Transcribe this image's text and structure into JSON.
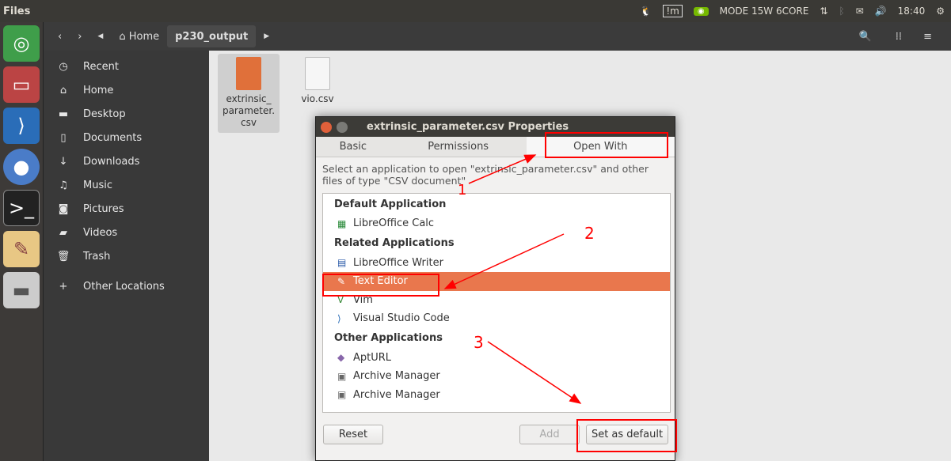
{
  "topbar": {
    "title": "Files",
    "mode": "MODE 15W 6CORE",
    "time": "18:40"
  },
  "launcher": [
    "ubuntu-icon",
    "files-icon",
    "vscode-icon",
    "chromium-icon",
    "terminal-icon",
    "text-editor-icon",
    "drive-icon"
  ],
  "headerbar": {
    "crumbs": [
      "Home",
      "p230_output"
    ]
  },
  "sidebar": {
    "items": [
      {
        "label": "Recent",
        "icon": "clock-icon"
      },
      {
        "label": "Home",
        "icon": "home-icon"
      },
      {
        "label": "Desktop",
        "icon": "folder-icon"
      },
      {
        "label": "Documents",
        "icon": "document-icon"
      },
      {
        "label": "Downloads",
        "icon": "download-icon"
      },
      {
        "label": "Music",
        "icon": "music-icon"
      },
      {
        "label": "Pictures",
        "icon": "camera-icon"
      },
      {
        "label": "Videos",
        "icon": "video-icon"
      },
      {
        "label": "Trash",
        "icon": "trash-icon"
      },
      {
        "label": "Other Locations",
        "icon": "plus-icon"
      }
    ]
  },
  "files": [
    {
      "name": "extrinsic_\nparameter.\ncsv",
      "color": "#e0703a"
    },
    {
      "name": "vio.csv",
      "color": "#f4f4f4"
    }
  ],
  "dialog": {
    "title": "extrinsic_parameter.csv Properties",
    "tabs": [
      "Basic",
      "Permissions",
      "Open With"
    ],
    "description": "Select an application to open \"extrinsic_parameter.csv\" and other files of type \"CSV document\"",
    "sections": {
      "default": "Default Application",
      "related": "Related Applications",
      "other": "Other Applications"
    },
    "default_apps": [
      "LibreOffice Calc"
    ],
    "related_apps": [
      "LibreOffice Writer",
      "Text Editor",
      "Vim",
      "Visual Studio Code"
    ],
    "other_apps": [
      "AptURL",
      "Archive Manager",
      "Archive Manager"
    ],
    "selected": "Text Editor",
    "buttons": {
      "reset": "Reset",
      "add": "Add",
      "set_default": "Set as default"
    }
  },
  "annotations": [
    "1",
    "2",
    "3"
  ],
  "colors": {
    "accent": "#e9774d",
    "annotation": "#ff0000"
  }
}
